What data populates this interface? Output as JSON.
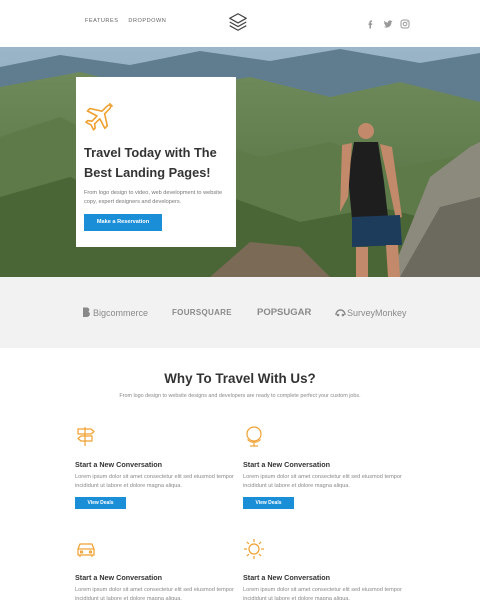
{
  "header": {
    "nav": [
      "FEATURES",
      "DROPDOWN"
    ],
    "logo_icon": "layers-logo-icon",
    "social": [
      "facebook-icon",
      "twitter-icon",
      "instagram-icon"
    ]
  },
  "hero": {
    "title": "Travel Today with The Best Landing Pages!",
    "text": "From logo design to video, web development to website copy, expert designers and developers.",
    "button": "Make a Reservation",
    "icon": "airplane-icon"
  },
  "brands": [
    "Bigcommerce",
    "FOURSQUARE",
    "POPSUGAR",
    "SurveyMonkey"
  ],
  "why": {
    "title": "Why To Travel With Us?",
    "subtitle": "From logo design to website designs and developers are ready to complete perfect your custom jobs."
  },
  "features": [
    {
      "icon": "signpost-icon",
      "title": "Start a New Conversation",
      "text": "Lorem ipsum dolor sit amet consectetur elit sed eiusmod tempor incididunt ut labore et dolore magna aliqua.",
      "button": "View Deals"
    },
    {
      "icon": "globe-icon",
      "title": "Start a New Conversation",
      "text": "Lorem ipsum dolor sit amet consectetur elit sed eiusmod tempor incididunt ut labore et dolore magna aliqua.",
      "button": "View Deals"
    },
    {
      "icon": "car-icon",
      "title": "Start a New Conversation",
      "text": "Lorem ipsum dolor sit amet consectetur elit sed eiusmod tempor incididunt ut labore et dolore magna aliqua."
    },
    {
      "icon": "sun-icon",
      "title": "Start a New Conversation",
      "text": "Lorem ipsum dolor sit amet consectetur elit sed eiusmod tempor incididunt ut labore et dolore magna aliqua."
    }
  ],
  "colors": {
    "accent": "#1a8fd8",
    "icon_orange": "#f0a030",
    "band_gray": "#f2f2f2"
  }
}
